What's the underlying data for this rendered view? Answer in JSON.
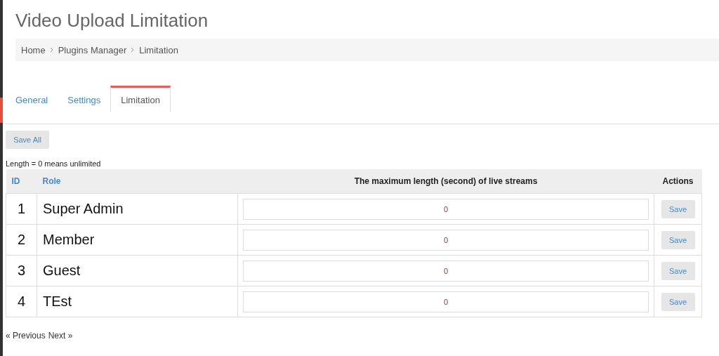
{
  "page_title": "Video Upload Limitation",
  "breadcrumb": [
    "Home",
    "Plugins Manager",
    "Limitation"
  ],
  "tabs": [
    {
      "label": "General",
      "selected": false
    },
    {
      "label": "Settings",
      "selected": false
    },
    {
      "label": "Limitation",
      "selected": true
    }
  ],
  "save_all_button": "Save All",
  "note": "Length = 0 means unlimited",
  "table": {
    "columns": [
      "ID",
      "Role",
      "The maximum length (second) of live streams",
      "Actions"
    ],
    "rows": [
      {
        "id": "1",
        "role": "Super Admin",
        "value": "0",
        "action": "Save"
      },
      {
        "id": "2",
        "role": "Member",
        "value": "0",
        "action": "Save"
      },
      {
        "id": "3",
        "role": "Guest",
        "value": "0",
        "action": "Save"
      },
      {
        "id": "4",
        "role": "TEst",
        "value": "0",
        "action": "Save"
      }
    ]
  },
  "pagination": [
    "« Previous",
    "Next »"
  ]
}
